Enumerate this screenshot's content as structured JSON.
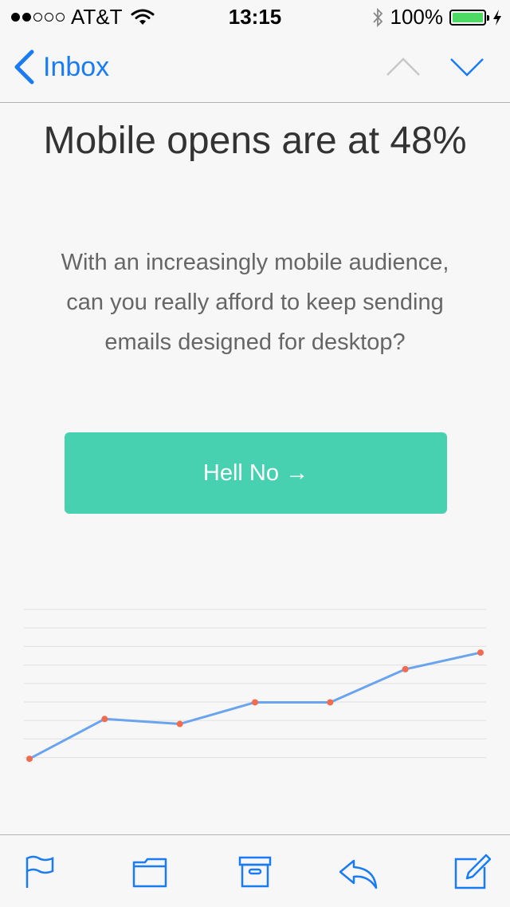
{
  "status_bar": {
    "carrier": "AT&T",
    "time": "13:15",
    "battery": "100%"
  },
  "nav": {
    "back_label": "Inbox"
  },
  "content": {
    "headline": "Mobile opens are at 48%",
    "body": "With an increasingly mobile audience, can you really afford to keep sending emails designed for desktop?",
    "cta_label": "Hell No →"
  },
  "chart_data": {
    "type": "line",
    "title": "",
    "xlabel": "",
    "ylabel": "",
    "x": [
      1,
      2,
      3,
      4,
      5,
      6,
      7
    ],
    "values": [
      1.0,
      3.4,
      3.1,
      4.4,
      4.4,
      6.4,
      7.4
    ],
    "ylim": [
      0,
      10
    ],
    "grid": true,
    "line_color": "#6aa3ee",
    "point_color": "#f26b4c"
  },
  "toolbar": {
    "icons": [
      "flag-icon",
      "folder-icon",
      "archive-icon",
      "reply-icon",
      "compose-icon"
    ]
  },
  "colors": {
    "accent": "#1a7cf5",
    "cta": "#48d1b0"
  }
}
